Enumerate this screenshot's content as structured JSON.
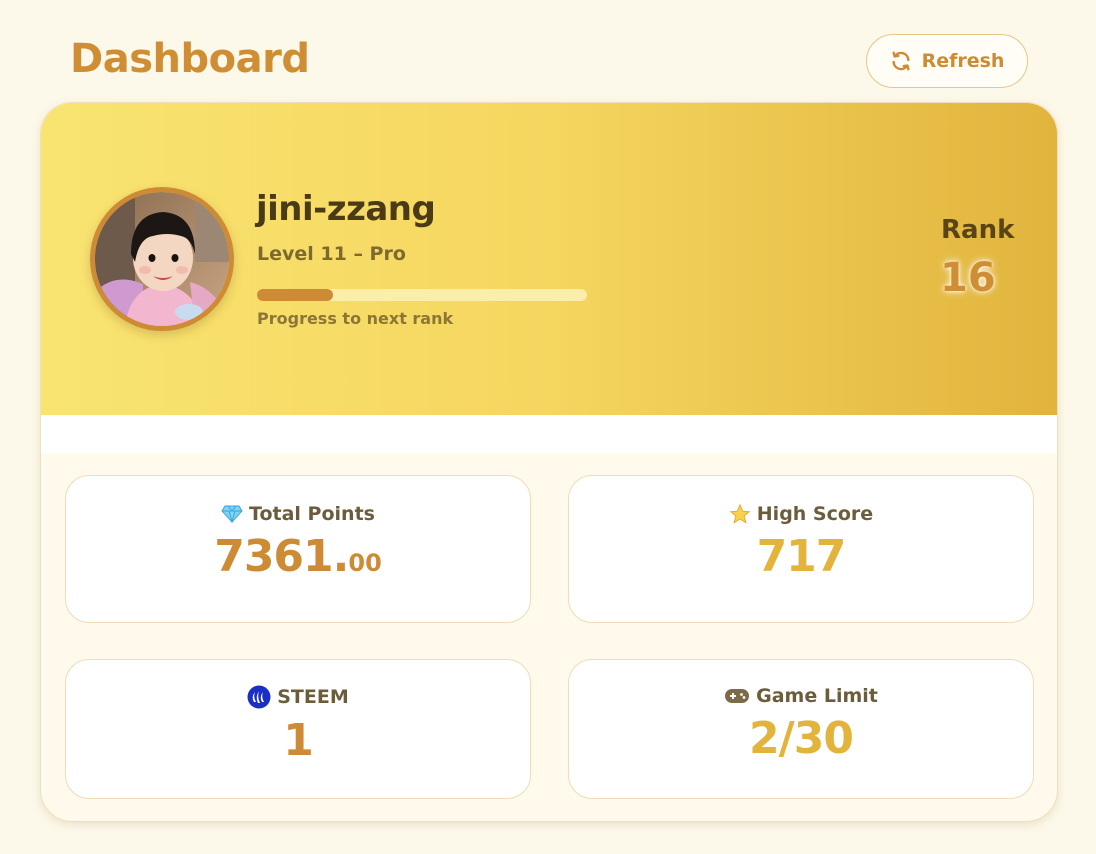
{
  "page": {
    "title": "Dashboard"
  },
  "toolbar": {
    "refresh_label": "Refresh"
  },
  "profile": {
    "username": "jini-zzang",
    "level": "Level 11 – Pro",
    "progress": 0.23,
    "progress_label": "Progress to next rank",
    "rank_label": "Rank",
    "rank_value": "16"
  },
  "stats": [
    {
      "label": "Total Points",
      "icon": "gem-icon",
      "value_int": "7361.",
      "value_dec": "00"
    },
    {
      "label": "High Score",
      "icon": "star-icon",
      "value": "717"
    },
    {
      "label": "STEEM",
      "icon": "steem-icon",
      "value": "1"
    },
    {
      "label": "Game Limit",
      "icon": "gamepad-icon",
      "value": "2/30"
    }
  ],
  "colors": {
    "accent": "#cd8b35",
    "gold": "#e3b43c",
    "background": "#fdf9ea",
    "banner_start": "#f9e472",
    "banner_end": "#e1b43d"
  }
}
